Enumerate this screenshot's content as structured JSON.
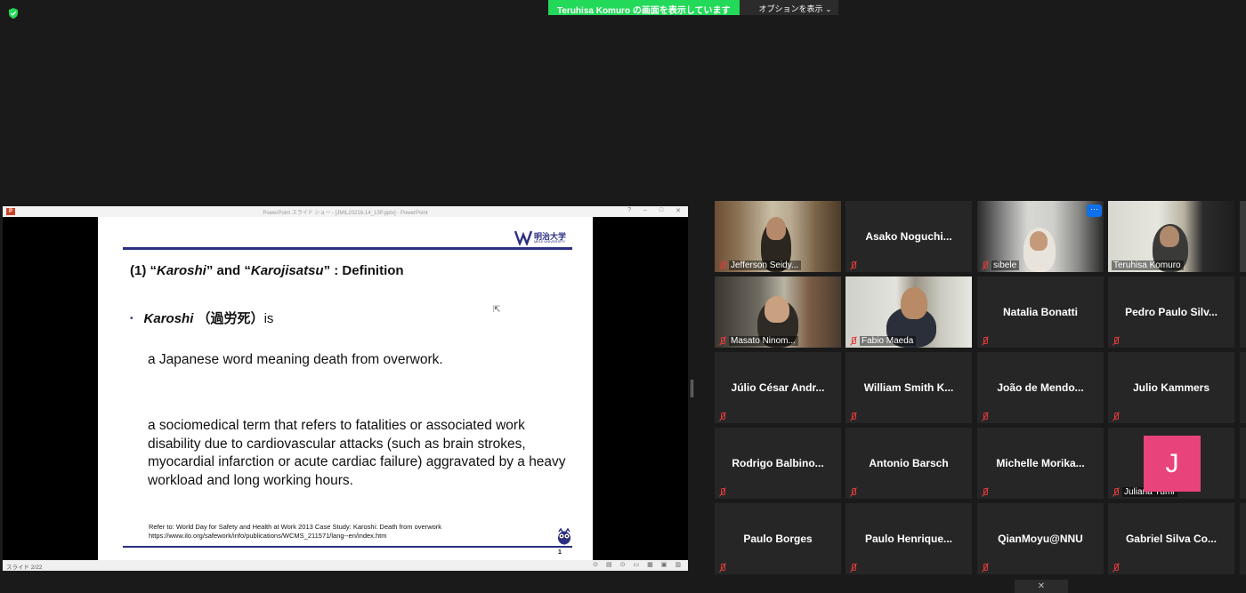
{
  "security": {
    "icon": "shield-check-icon",
    "color": "#23d959"
  },
  "share_banner": {
    "label": "Teruhisa Komuro の画面を表示しています",
    "options_label": "オプションを表示",
    "color": "#23d959"
  },
  "powerpoint": {
    "window_title": "PowerPoint スライド ショー - [JMIL20216-14_13P.pptx] - PowerPoint",
    "status_left": "スライド 2/22"
  },
  "slide": {
    "logo_text": "明治大学",
    "logo_sub": "MEIJI UNIVERSITY",
    "heading_prefix": "(1)  “",
    "heading_term1": "Karoshi",
    "heading_mid": "” and “",
    "heading_term2": "Karojisatsu",
    "heading_suffix": "” : Definition",
    "bullet_term": "Karoshi",
    "bullet_kanji": "（過労死）",
    "bullet_is": "is",
    "line1": "a Japanese word meaning death from overwork.",
    "para2": "a sociomedical term that refers to fatalities or associated work disability due to cardiovascular attacks (such as brain strokes, myocardial infarction or acute cardiac failure) aggravated by a heavy workload and long working hours.",
    "ref_line1": "Refer to: World Day for Safety and Health at Work 2013  Case Study: Karoshi: Death from overwork",
    "ref_line2": "https://www.ilo.org/safework/info/publications/WCMS_211571/lang--en/index.htm",
    "page_number": "1",
    "accent_color": "#2c2f80"
  },
  "gallery": {
    "participants": [
      {
        "name": "Jefferson Seidy...",
        "video": true
      },
      {
        "name": "Asako  Noguchi...",
        "video": false
      },
      {
        "name": "sibele",
        "video": true
      },
      {
        "name": "Teruhisa Komuro",
        "video": true,
        "speaking": true
      },
      {
        "name": "Masato Ninom...",
        "video": true
      },
      {
        "name": "Fabio Maeda",
        "video": true
      },
      {
        "name": "Natalia Bonatti",
        "video": false
      },
      {
        "name": "Pedro Paulo Silv...",
        "video": false
      },
      {
        "name": "Júlio César Andr...",
        "video": false
      },
      {
        "name": "William Smith K...",
        "video": false
      },
      {
        "name": "João de Mendo...",
        "video": false
      },
      {
        "name": "Julio Kammers",
        "video": false
      },
      {
        "name": "Rodrigo  Balbino...",
        "video": false
      },
      {
        "name": "Antonio Barsch",
        "video": false
      },
      {
        "name": "Michelle  Morika...",
        "video": false
      },
      {
        "name": "Juliana Yumi",
        "video": false,
        "avatar_letter": "J",
        "avatar_color": "#e8437a"
      },
      {
        "name": "Paulo Borges",
        "video": false
      },
      {
        "name": "Paulo  Henrique...",
        "video": false
      },
      {
        "name": "QianMoyu@NNU",
        "video": false
      },
      {
        "name": "Gabriel Silva Co...",
        "video": false
      }
    ],
    "more_button": "···",
    "bottom_toggle": "✕"
  }
}
